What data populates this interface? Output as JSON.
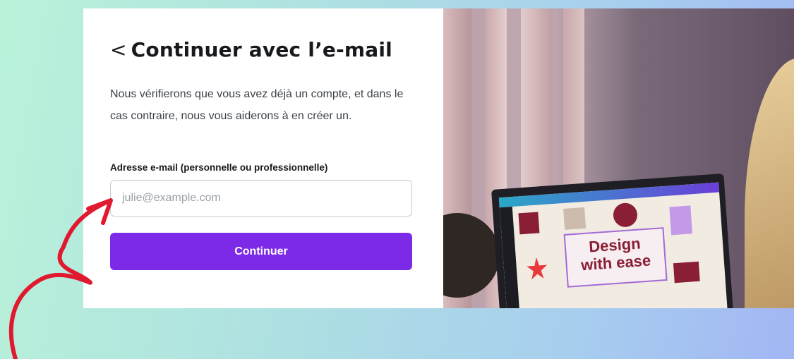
{
  "signin": {
    "back_glyph": "<",
    "title": "Continuer avec l’e-mail",
    "description": "Nous vérifierons que vous avez déjà un compte, et dans le cas contraire, nous vous aiderons à en créer un.",
    "email_label": "Adresse e-mail (personnelle ou professionnelle)",
    "email_placeholder": "julie@example.com",
    "email_value": "",
    "continue_label": "Continuer"
  },
  "photo": {
    "design_text_line1": "Design",
    "design_text_line2": "with ease"
  },
  "colors": {
    "accent": "#7d2ae8",
    "annotation_arrow": "#e0192f"
  },
  "icons": [
    "chevron-left-icon",
    "arrow-annotation-icon"
  ]
}
